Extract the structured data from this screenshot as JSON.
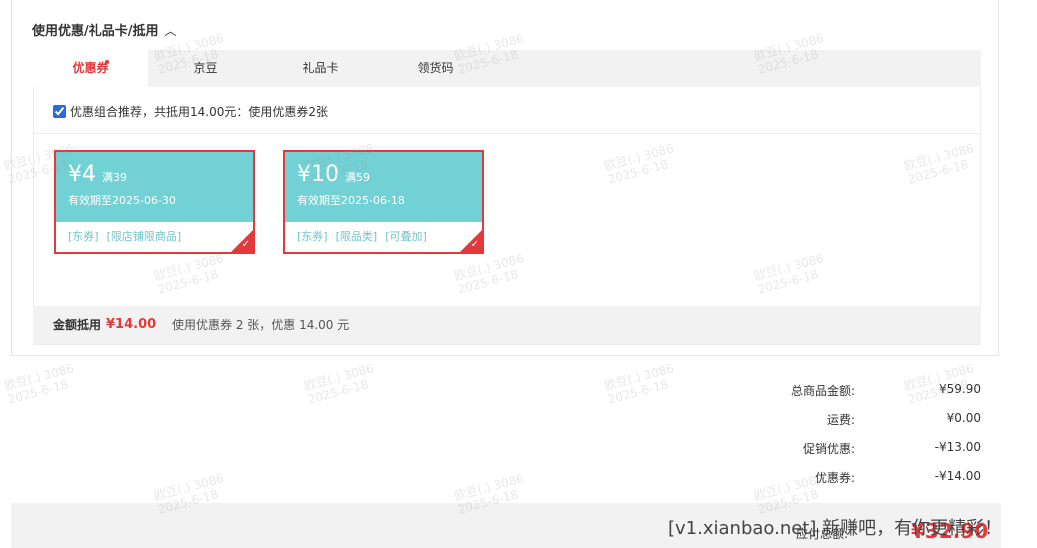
{
  "section": {
    "title": "使用优惠/礼品卡/抵用",
    "toggle_icon": "chevron-up-icon"
  },
  "tabs": [
    {
      "label": "优惠券",
      "active": true,
      "badge_dot": true
    },
    {
      "label": "京豆",
      "active": false
    },
    {
      "label": "礼品卡",
      "active": false
    },
    {
      "label": "领货码",
      "active": false
    }
  ],
  "combo": {
    "checked": true,
    "label": "优惠组合推荐，共抵用14.00元：使用优惠券2张"
  },
  "coupons": [
    {
      "amount": "¥4",
      "min": "满39",
      "expiry": "有效期至2025-06-30",
      "tags": [
        "[东券]",
        "[限店铺限商品]"
      ],
      "selected": true
    },
    {
      "amount": "¥10",
      "min": "满59",
      "expiry": "有效期至2025-06-18",
      "tags": [
        "[东券]",
        "[限品类]",
        "[可叠加]"
      ],
      "selected": true
    }
  ],
  "summary": {
    "label": "金额抵用",
    "value": "¥14.00",
    "note": "使用优惠券 2 张，优惠 14.00 元"
  },
  "totals": [
    {
      "key": "总商品金额:",
      "value": "¥59.90"
    },
    {
      "key": "运费:",
      "value": "¥0.00"
    },
    {
      "key": "促销优惠:",
      "value": "-¥13.00"
    },
    {
      "key": "优惠券:",
      "value": "-¥14.00"
    }
  ],
  "bottom": {
    "due_label": "应付总额:",
    "due_value": "¥32.90"
  },
  "overlay_text": "[v1.xianbao.net] 新赚吧，有你更精彩！",
  "watermark": {
    "line1": "欧豆(.) 3086",
    "line2": "2025-6-18"
  },
  "colors": {
    "accent": "#e4393c",
    "coupon_bg": "#72d1d4",
    "tag": "#72c4c7"
  }
}
